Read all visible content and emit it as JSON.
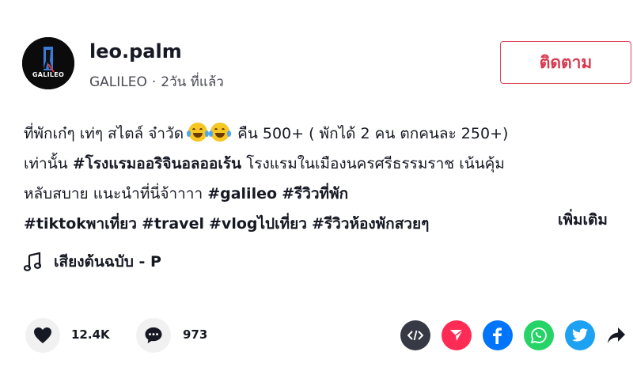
{
  "author": {
    "username": "leo.palm",
    "avatar_text": "GALILEO",
    "display_name": "GALILEO",
    "time_ago": "2วัน ที่แล้ว",
    "follow_label": "ติดตาม"
  },
  "caption": {
    "line1_text": "ที่พักเก๋ๆ เท่ๆ สไตล์ จ๋าวัด",
    "line1_after": "คืน 500+ ( พักได้ 2 คน ตกคนละ 250+)",
    "line2_pre": "เท่านั้น",
    "line2_tag": "#โรงแรมออริจินอลออเร้น",
    "line2_post": "โรงแรมในเมืองนครศรีธรรมราช เน้นคุ้ม",
    "line3_pre": "หลับสบาย แนะนำที่นี่จ้าาาา",
    "line3_tag1": "#galileo",
    "line3_tag2": "#รีวิวที่พัก",
    "line4_tag1": "#tiktokพาเที่ยว",
    "line4_tag2": "#travel",
    "line4_tag3": "#vlogไปเที่ยว",
    "line4_tag4": "#รีวิวห้องพักสวยๆ",
    "more_label": "เพิ่มเติม"
  },
  "music": {
    "title": "เสียงต้นฉบับ - P",
    "icon": "music-note-icon"
  },
  "stats": {
    "likes": "12.4K",
    "comments": "973"
  },
  "share": {
    "embed_color": "#373a45",
    "send_color": "#fe2c55",
    "facebook_color": "#0075fa",
    "whatsapp_color": "#25d366",
    "twitter_color": "#1da1f2"
  }
}
